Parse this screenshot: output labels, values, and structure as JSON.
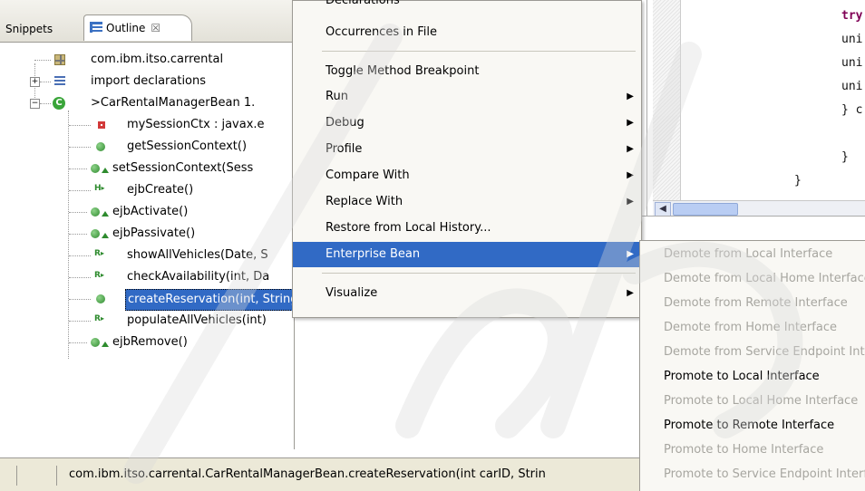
{
  "outline_view": {
    "tabs": [
      {
        "label": "Snippets"
      },
      {
        "label": "Outline",
        "close": "☒"
      }
    ],
    "tree": [
      {
        "label": "com.ibm.itso.carrental",
        "icon": "package-icon"
      },
      {
        "label": "import declarations",
        "icon": "imports-icon",
        "toggle": "+"
      },
      {
        "label": ">CarRentalManagerBean  1.",
        "icon": "class-icon",
        "toggle": "−"
      },
      {
        "label": "mySessionCtx : javax.e",
        "icon": "private-field-icon"
      },
      {
        "label": "getSessionContext()",
        "icon": "public-method-icon"
      },
      {
        "label": "setSessionContext(Sess",
        "icon": "public-method-override-icon"
      },
      {
        "label": "ejbCreate()",
        "icon": "home-method-icon"
      },
      {
        "label": "ejbActivate()",
        "icon": "public-method-override-icon"
      },
      {
        "label": "ejbPassivate()",
        "icon": "public-method-override-icon"
      },
      {
        "label": "showAllVehicles(Date, S",
        "icon": "local-remote-method-icon"
      },
      {
        "label": "checkAvailability(int, Da",
        "icon": "local-remote-method-icon"
      },
      {
        "label": "createReservation(int, String)",
        "icon": "public-method-icon",
        "selected": true
      },
      {
        "label": "populateAllVehicles(int)",
        "icon": "local-remote-method-icon"
      },
      {
        "label": "ejbRemove()",
        "icon": "public-method-override-icon"
      }
    ]
  },
  "context_menu": {
    "items": [
      {
        "label": "Declarations"
      },
      {
        "label": "Occurrences in File"
      },
      {
        "label": "Toggle Method Breakpoint"
      },
      {
        "label": "Run",
        "arrow": "▶"
      },
      {
        "label": "Debug",
        "arrow": "▶"
      },
      {
        "label": "Profile",
        "arrow": "▶"
      },
      {
        "label": "Compare With",
        "arrow": "▶"
      },
      {
        "label": "Replace With",
        "arrow": "▶"
      },
      {
        "label": "Restore from Local History..."
      },
      {
        "label": "Enterprise Bean",
        "arrow": "▶",
        "active": true
      },
      {
        "label": "Visualize",
        "arrow": "▶"
      }
    ]
  },
  "submenu": {
    "items": [
      {
        "label": "Demote from Local Interface",
        "enabled": false
      },
      {
        "label": "Demote from Local Home Interface",
        "enabled": false
      },
      {
        "label": "Demote from Remote Interface",
        "enabled": false
      },
      {
        "label": "Demote from Home Interface",
        "enabled": false
      },
      {
        "label": "Demote from Service Endpoint Interface",
        "enabled": false
      },
      {
        "label": "Promote to Local Interface",
        "enabled": true
      },
      {
        "label": "Promote to Local Home Interface",
        "enabled": false
      },
      {
        "label": "Promote to Remote Interface",
        "enabled": true
      },
      {
        "label": "Promote to Home Interface",
        "enabled": false
      },
      {
        "label": "Promote to Service Endpoint Interface",
        "enabled": false
      }
    ]
  },
  "editor": {
    "lines": [
      "try",
      "uni",
      "uni",
      "uni",
      "} c",
      "}",
      "}"
    ]
  },
  "status_bar": {
    "text": "com.ibm.itso.carrental.CarRentalManagerBean.createReservation(int carID, Strin"
  },
  "colors": {
    "selection": "#316ac5",
    "menu_bg": "#f9f8f4",
    "disabled_text": "#a7a6a0",
    "keyword": "#7f0055"
  }
}
